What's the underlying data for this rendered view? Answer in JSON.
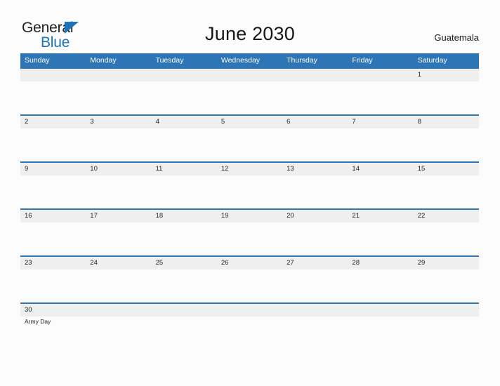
{
  "logo": {
    "word_one": "General",
    "word_two": "Blue",
    "flag_icon": "blue-triangle-flag-icon",
    "accent_color": "#1b74bb"
  },
  "header": {
    "title": "June 2030",
    "country": "Guatemala"
  },
  "colors": {
    "header_blue": "#2e75b6",
    "row_separator_blue": "#2e75b6",
    "date_band_gray": "#efefef",
    "page_background": "#fcfcfc",
    "text": "#222222"
  },
  "calendar": {
    "weekdays": [
      "Sunday",
      "Monday",
      "Tuesday",
      "Wednesday",
      "Thursday",
      "Friday",
      "Saturday"
    ],
    "weeks": [
      {
        "days": [
          {
            "date": "",
            "event": ""
          },
          {
            "date": "",
            "event": ""
          },
          {
            "date": "",
            "event": ""
          },
          {
            "date": "",
            "event": ""
          },
          {
            "date": "",
            "event": ""
          },
          {
            "date": "",
            "event": ""
          },
          {
            "date": "1",
            "event": ""
          }
        ]
      },
      {
        "days": [
          {
            "date": "2",
            "event": ""
          },
          {
            "date": "3",
            "event": ""
          },
          {
            "date": "4",
            "event": ""
          },
          {
            "date": "5",
            "event": ""
          },
          {
            "date": "6",
            "event": ""
          },
          {
            "date": "7",
            "event": ""
          },
          {
            "date": "8",
            "event": ""
          }
        ]
      },
      {
        "days": [
          {
            "date": "9",
            "event": ""
          },
          {
            "date": "10",
            "event": ""
          },
          {
            "date": "11",
            "event": ""
          },
          {
            "date": "12",
            "event": ""
          },
          {
            "date": "13",
            "event": ""
          },
          {
            "date": "14",
            "event": ""
          },
          {
            "date": "15",
            "event": ""
          }
        ]
      },
      {
        "days": [
          {
            "date": "16",
            "event": ""
          },
          {
            "date": "17",
            "event": ""
          },
          {
            "date": "18",
            "event": ""
          },
          {
            "date": "19",
            "event": ""
          },
          {
            "date": "20",
            "event": ""
          },
          {
            "date": "21",
            "event": ""
          },
          {
            "date": "22",
            "event": ""
          }
        ]
      },
      {
        "days": [
          {
            "date": "23",
            "event": ""
          },
          {
            "date": "24",
            "event": ""
          },
          {
            "date": "25",
            "event": ""
          },
          {
            "date": "26",
            "event": ""
          },
          {
            "date": "27",
            "event": ""
          },
          {
            "date": "28",
            "event": ""
          },
          {
            "date": "29",
            "event": ""
          }
        ]
      },
      {
        "days": [
          {
            "date": "30",
            "event": "Army Day"
          },
          {
            "date": "",
            "event": ""
          },
          {
            "date": "",
            "event": ""
          },
          {
            "date": "",
            "event": ""
          },
          {
            "date": "",
            "event": ""
          },
          {
            "date": "",
            "event": ""
          },
          {
            "date": "",
            "event": ""
          }
        ]
      }
    ]
  }
}
